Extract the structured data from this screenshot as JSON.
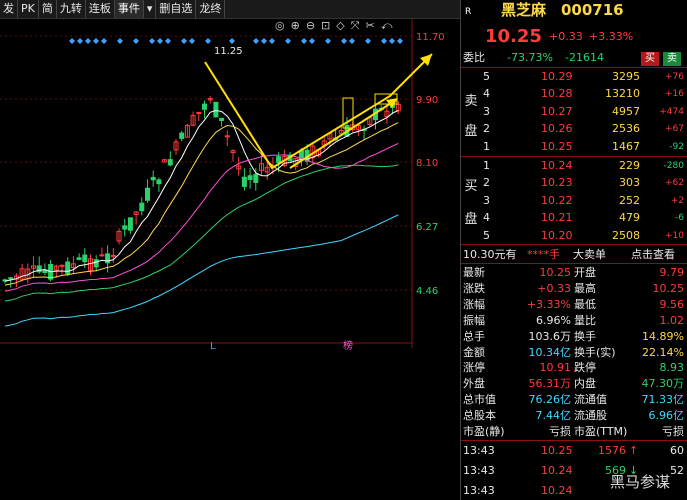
{
  "toolbar": {
    "items": [
      "发",
      "PK",
      "简",
      "九转",
      "连板",
      "事件",
      "▾",
      "删自选",
      "龙终",
      "",
      "",
      "",
      "",
      ""
    ],
    "row2": [
      "◎",
      "⊕",
      "⊖",
      "⊡",
      "◇",
      "⤧",
      "✂",
      "⤺"
    ]
  },
  "chart": {
    "price_labels": [
      "11.70",
      "9.90",
      "8.10",
      "6.27",
      "4.46"
    ],
    "high_label": "11.25",
    "marker_L": "L",
    "marker_bang": "榜",
    "colors": {
      "up": "#ff3b3b",
      "down": "#29d36b",
      "ma5": "#ffffff",
      "ma10": "#ffd84a",
      "ma20": "#ff4fd8",
      "ma30": "#29d36b",
      "ma60": "#3fd8ff",
      "arrow": "#ffe000",
      "diamond": "#3fa0ff"
    }
  },
  "quote": {
    "corner": "R",
    "name": "黑芝麻",
    "code": "000716",
    "price": "10.25",
    "change": "+0.33",
    "pct": "+3.33%",
    "weibi_label": "委比",
    "weibi_pct": "-73.73%",
    "weibi_val": "-21614",
    "buy_btn": "买",
    "sell_btn": "卖",
    "sell_side": [
      "卖",
      "盘"
    ],
    "buy_side": [
      "买",
      "盘"
    ]
  },
  "asks": [
    {
      "lvl": "5",
      "price": "10.29",
      "vol": "3295",
      "chg": "+76"
    },
    {
      "lvl": "4",
      "price": "10.28",
      "vol": "13210",
      "chg": "+16"
    },
    {
      "lvl": "3",
      "price": "10.27",
      "vol": "4957",
      "chg": "+474"
    },
    {
      "lvl": "2",
      "price": "10.26",
      "vol": "2536",
      "chg": "+67"
    },
    {
      "lvl": "1",
      "price": "10.25",
      "vol": "1467",
      "chg": "-92"
    }
  ],
  "bids": [
    {
      "lvl": "1",
      "price": "10.24",
      "vol": "229",
      "chg": "-280"
    },
    {
      "lvl": "2",
      "price": "10.23",
      "vol": "303",
      "chg": "+62"
    },
    {
      "lvl": "3",
      "price": "10.22",
      "vol": "252",
      "chg": "+2"
    },
    {
      "lvl": "4",
      "price": "10.21",
      "vol": "479",
      "chg": "-6"
    },
    {
      "lvl": "5",
      "price": "10.20",
      "vol": "2508",
      "chg": "+10"
    }
  ],
  "extra_line": {
    "a": "10.30元有",
    "b": "****手",
    "c": "大卖单",
    "d": "点击查看"
  },
  "stats": [
    {
      "l1": "最新",
      "v1": "10.25",
      "l2": "开盘",
      "v2": "9.79"
    },
    {
      "l1": "涨跌",
      "v1": "+0.33",
      "l2": "最高",
      "v2": "10.25"
    },
    {
      "l1": "涨幅",
      "v1": "+3.33%",
      "l2": "最低",
      "v2": "9.56"
    },
    {
      "l1": "振幅",
      "v1": "6.96%",
      "l2": "量比",
      "v2": "1.02"
    },
    {
      "l1": "总手",
      "v1": "103.6万",
      "l2": "换手",
      "v2": "14.89%"
    },
    {
      "l1": "金额",
      "v1": "10.34亿",
      "l2": "换手(实)",
      "v2": "22.14%"
    },
    {
      "l1": "涨停",
      "v1": "10.91",
      "l2": "跌停",
      "v2": "8.93"
    },
    {
      "l1": "外盘",
      "v1": "56.31万",
      "l2": "内盘",
      "v2": "47.30万"
    },
    {
      "l1": "总市值",
      "v1": "76.26亿",
      "l2": "流通值",
      "v2": "71.33亿"
    },
    {
      "l1": "总股本",
      "v1": "7.44亿",
      "l2": "流通股",
      "v2": "6.96亿"
    },
    {
      "l1": "市盈(静)",
      "v1": "亏损",
      "l2": "市盈(TTM)",
      "v2": "亏损"
    }
  ],
  "ticks": [
    {
      "time": "13:43",
      "price": "10.25",
      "vol": "1576",
      "dir": "↑",
      "n": "60"
    },
    {
      "time": "13:43",
      "price": "10.24",
      "vol": "569",
      "dir": "↓",
      "n": "52"
    },
    {
      "time": "13:43",
      "price": "10.24",
      "vol": "",
      "dir": "",
      "n": ""
    }
  ],
  "watermark": "黑马参谋"
}
